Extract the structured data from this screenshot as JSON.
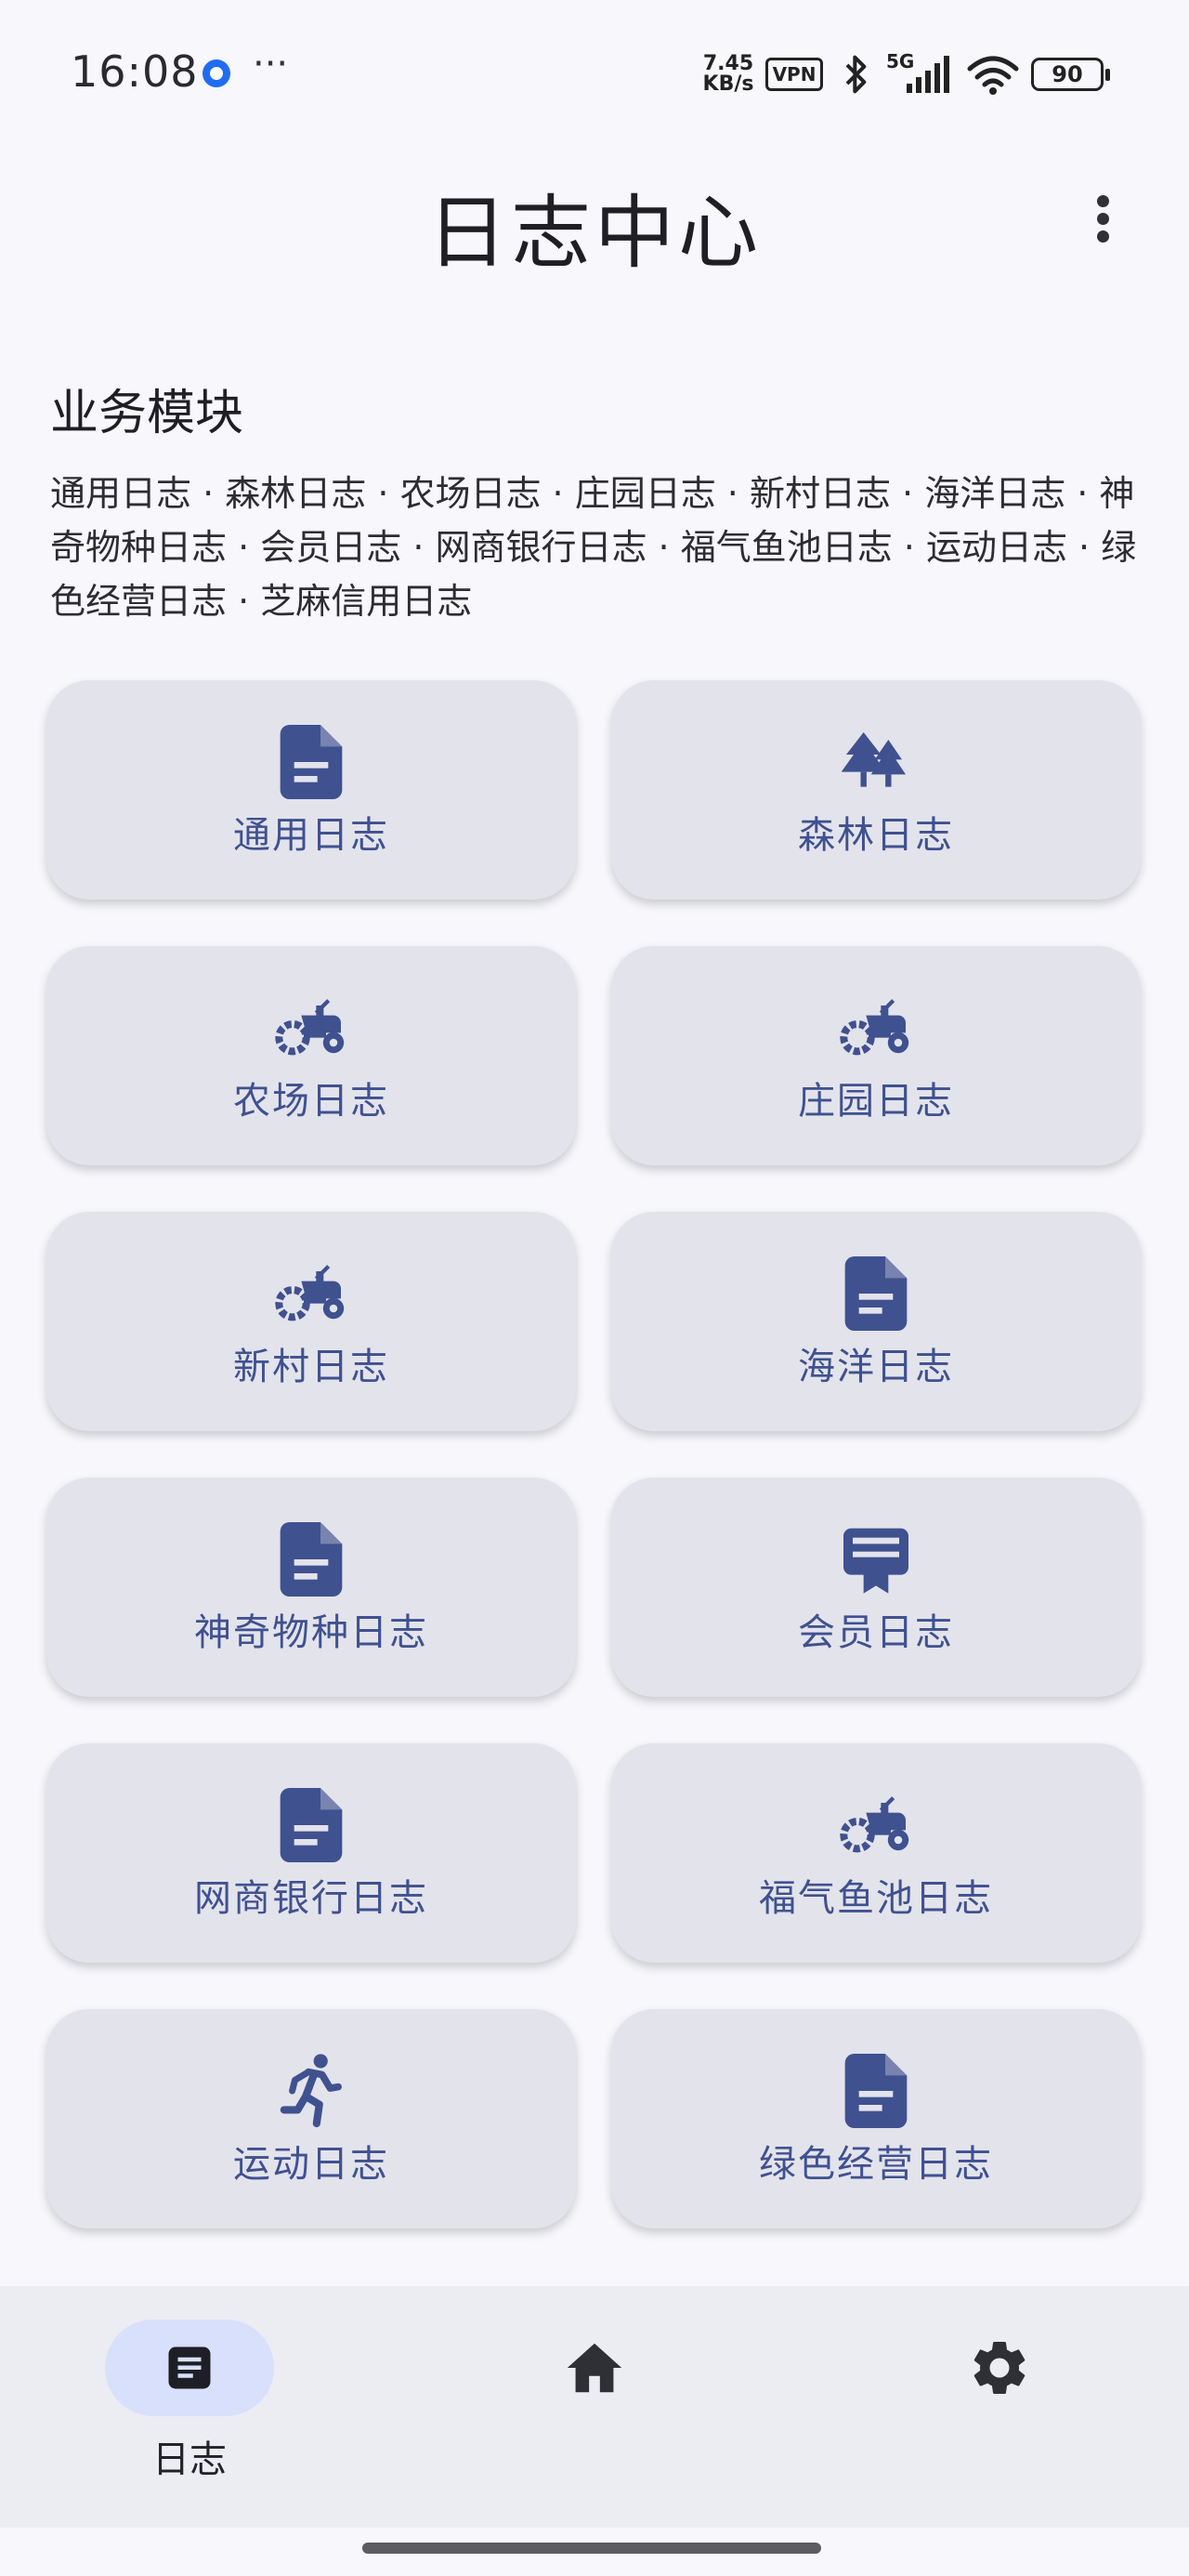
{
  "status_bar": {
    "time": "16:08",
    "more": "···",
    "net_speed_value": "7.45",
    "net_speed_unit": "KB/s",
    "vpn": "VPN",
    "network_type": "5G",
    "battery": "90"
  },
  "header": {
    "title": "日志中心"
  },
  "section": {
    "title": "业务模块",
    "description": "通用日志 · 森林日志 · 农场日志 · 庄园日志 · 新村日志 · 海洋日志 · 神奇物种日志 · 会员日志 · 网商银行日志 · 福气鱼池日志 · 运动日志 · 绿色经营日志 · 芝麻信用日志"
  },
  "modules": [
    {
      "label": "通用日志",
      "icon": "document-icon"
    },
    {
      "label": "森林日志",
      "icon": "forest-icon"
    },
    {
      "label": "农场日志",
      "icon": "tractor-icon"
    },
    {
      "label": "庄园日志",
      "icon": "tractor-icon"
    },
    {
      "label": "新村日志",
      "icon": "tractor-icon"
    },
    {
      "label": "海洋日志",
      "icon": "document-icon"
    },
    {
      "label": "神奇物种日志",
      "icon": "document-icon"
    },
    {
      "label": "会员日志",
      "icon": "membership-card-icon"
    },
    {
      "label": "网商银行日志",
      "icon": "document-icon"
    },
    {
      "label": "福气鱼池日志",
      "icon": "tractor-icon"
    },
    {
      "label": "运动日志",
      "icon": "running-icon"
    },
    {
      "label": "绿色经营日志",
      "icon": "document-icon"
    }
  ],
  "bottom_nav": {
    "items": [
      {
        "label": "日志",
        "icon": "log-icon",
        "active": true
      },
      {
        "label": "",
        "icon": "home-icon",
        "active": false
      },
      {
        "label": "",
        "icon": "settings-gear-icon",
        "active": false
      }
    ]
  },
  "colors": {
    "accent": "#3f518f",
    "card_bg": "#e3e3ec",
    "page_bg": "#f7f7fc",
    "nav_active_pill": "#d8e0fb"
  }
}
